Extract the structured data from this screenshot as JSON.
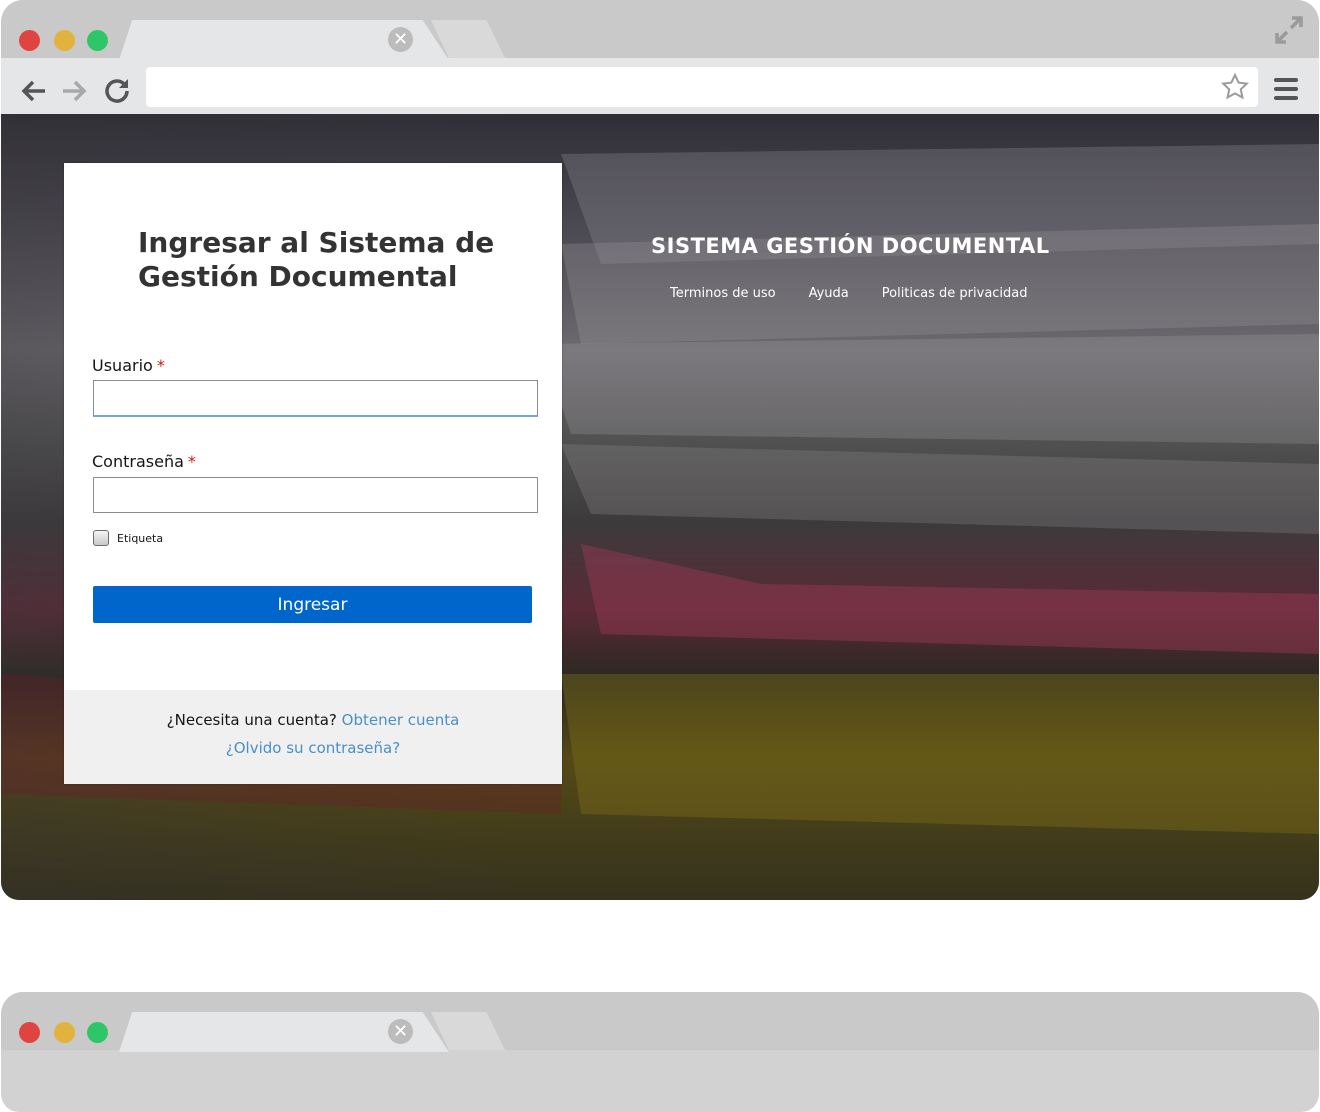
{
  "browser": {
    "tab_close_glyph": "✕"
  },
  "login": {
    "title": "Ingresar al Sistema de Gestión Documental",
    "username_label": "Usuario",
    "password_label": "Contraseña",
    "required_mark": "*",
    "checkbox_label": "Etiqueta",
    "submit_label": "Ingresar",
    "footer_prompt": "¿Necesita una cuenta?",
    "create_account_link": "Obtener cuenta",
    "forgot_password_link": "¿Olvido su contraseña?"
  },
  "brand": {
    "title": "SISTEMA GESTIÓN DOCUMENTAL"
  },
  "nav": {
    "items": [
      {
        "label": "Terminos de uso"
      },
      {
        "label": "Ayuda"
      },
      {
        "label": "Politicas de privacidad"
      }
    ]
  },
  "colors": {
    "primary_button": "#0066cc",
    "link": "#4a90c8",
    "required": "#c9190b"
  }
}
